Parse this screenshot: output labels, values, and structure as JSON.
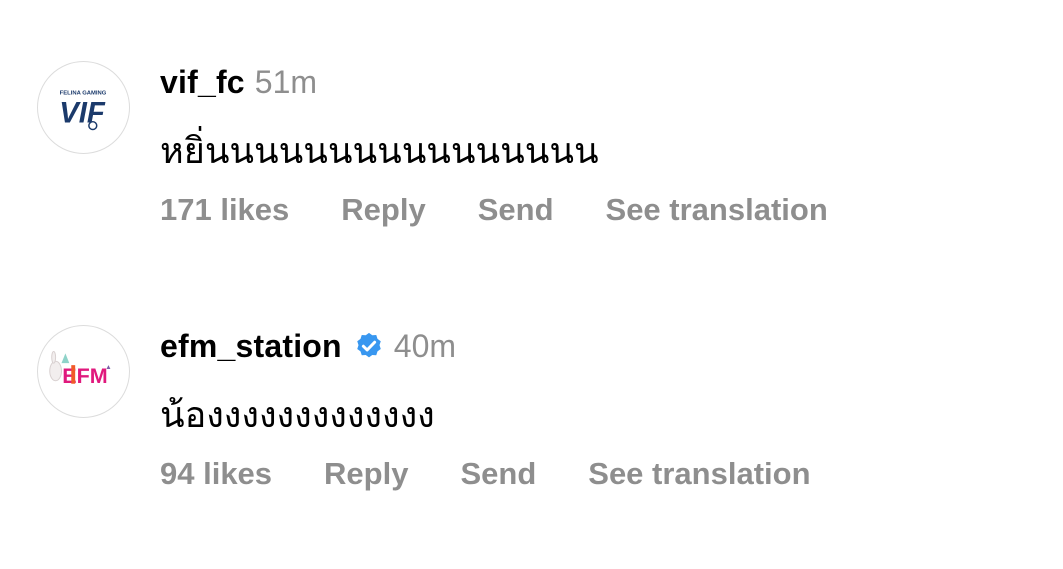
{
  "comments": [
    {
      "avatar_icon": "vif-logo-avatar",
      "avatar_text": "VIF",
      "avatar_subtext": "FELINA GAMING",
      "username": "vif_fc",
      "verified": false,
      "time": "51m",
      "text": "หยิ่นนนนนนนนนนนนนนนน",
      "likes": "171 likes",
      "reply": "Reply",
      "send": "Send",
      "translate": "See translation"
    },
    {
      "avatar_icon": "efm-logo-avatar",
      "avatar_text": "EFM",
      "username": "efm_station",
      "verified": true,
      "verified_color": "#3897f0",
      "time": "40m",
      "text": "น้องงงงงงงงงงงงง",
      "likes": "94 likes",
      "reply": "Reply",
      "send": "Send",
      "translate": "See translation"
    }
  ]
}
